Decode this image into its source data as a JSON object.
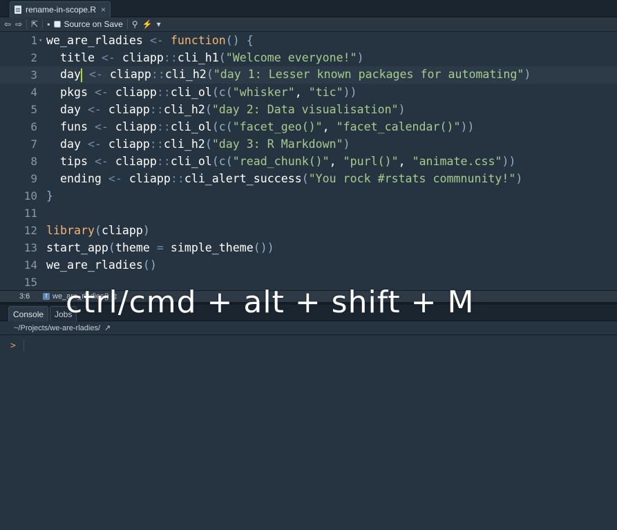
{
  "editor": {
    "tab": {
      "filename": "rename-in-scope.R",
      "close": "×"
    },
    "toolbar": {
      "back": "⇦",
      "forward": "⇨",
      "show_in_window": "⇱",
      "save": "▪",
      "source_on_save": "Source on Save",
      "search": "⚲",
      "wand": "⚡",
      "dropdown": "▾"
    },
    "lines": [
      {
        "n": "1",
        "fold": "▾"
      },
      {
        "n": "2"
      },
      {
        "n": "3"
      },
      {
        "n": "4"
      },
      {
        "n": "5"
      },
      {
        "n": "6"
      },
      {
        "n": "7"
      },
      {
        "n": "8"
      },
      {
        "n": "9"
      },
      {
        "n": "10"
      },
      {
        "n": "11"
      },
      {
        "n": "12"
      },
      {
        "n": "13"
      },
      {
        "n": "14"
      },
      {
        "n": "15"
      }
    ],
    "code": {
      "l1_name": "we_are_rladies",
      "l1_assign": " <- ",
      "l1_kw": "function",
      "l1_rest": "() {",
      "l2_var": "  title",
      "l2_assign": " <- ",
      "l2_ns": "cliapp",
      "l2_sep": "::",
      "l2_fn": "cli_h1",
      "l2_open": "(",
      "l2_str": "\"Welcome everyone!\"",
      "l2_close": ")",
      "l3_var": "  day",
      "l3_assign": " <- ",
      "l3_ns": "cliapp",
      "l3_sep": "::",
      "l3_fn": "cli_h2",
      "l3_open": "(",
      "l3_str": "\"day 1: Lesser known packages for automating\"",
      "l3_close": ")",
      "l4_var": "  pkgs",
      "l4_assign": " <- ",
      "l4_ns": "cliapp",
      "l4_sep": "::",
      "l4_fn": "cli_ol",
      "l4_open": "(c(",
      "l4_s1": "\"whisker\"",
      "l4_comma": ", ",
      "l4_s2": "\"tic\"",
      "l4_close": "))",
      "l5_var": "  day",
      "l5_assign": " <- ",
      "l5_ns": "cliapp",
      "l5_sep": "::",
      "l5_fn": "cli_h2",
      "l5_open": "(",
      "l5_str": "\"day 2: Data visualisation\"",
      "l5_close": ")",
      "l6_var": "  funs",
      "l6_assign": " <- ",
      "l6_ns": "cliapp",
      "l6_sep": "::",
      "l6_fn": "cli_ol",
      "l6_open": "(c(",
      "l6_s1": "\"facet_geo()\"",
      "l6_comma": ", ",
      "l6_s2": "\"facet_calendar()\"",
      "l6_close": "))",
      "l7_var": "  day",
      "l7_assign": " <- ",
      "l7_ns": "cliapp",
      "l7_sep": "::",
      "l7_fn": "cli_h2",
      "l7_open": "(",
      "l7_str": "\"day 3: R Markdown\"",
      "l7_close": ")",
      "l8_var": "  tips",
      "l8_assign": " <- ",
      "l8_ns": "cliapp",
      "l8_sep": "::",
      "l8_fn": "cli_ol",
      "l8_open": "(c(",
      "l8_s1": "\"read_chunk()\"",
      "l8_comma1": ", ",
      "l8_s2": "\"purl()\"",
      "l8_comma2": ", ",
      "l8_s3": "\"animate.css\"",
      "l8_close": "))",
      "l9_var": "  ending",
      "l9_assign": " <- ",
      "l9_ns": "cliapp",
      "l9_sep": "::",
      "l9_fn": "cli_alert_success",
      "l9_open": "(",
      "l9_str": "\"You rock #rstats commnunity!\"",
      "l9_close": ")",
      "l10": "}",
      "l12_fn": "library",
      "l12_open": "(",
      "l12_arg": "cliapp",
      "l12_close": ")",
      "l13_fn": "start_app",
      "l13_open": "(",
      "l13_arg": "theme",
      "l13_eq": " = ",
      "l13_val": "simple_theme",
      "l13_close": "())",
      "l14_fn": "we_are_rladies",
      "l14_close": "()"
    },
    "status": {
      "cursor_position": "3:6",
      "scope_badge": "f",
      "scope": "we_are_rladies()",
      "scope_arrow": "⇕"
    }
  },
  "console": {
    "tabs": [
      "Console",
      "Jobs"
    ],
    "path": "~/Projects/we-are-rladies/",
    "path_arrow": "↗",
    "prompt": ">"
  },
  "overlay": {
    "shortcut": "ctrl/cmd + alt + shift + M"
  }
}
